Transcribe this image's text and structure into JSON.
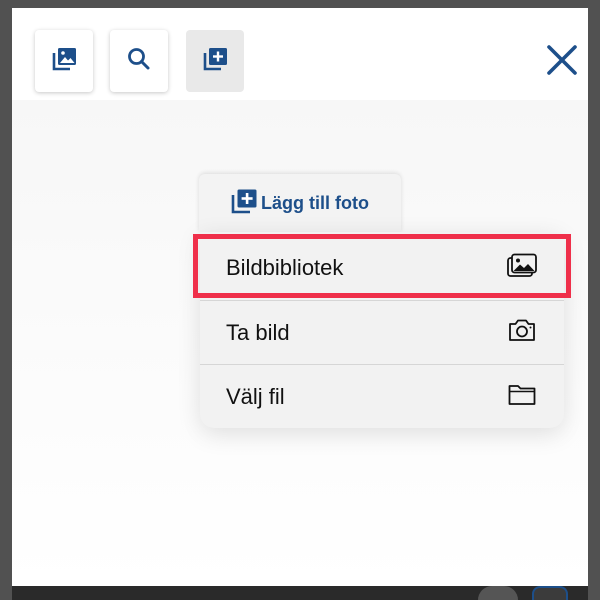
{
  "toolbar": {
    "gallery_icon": "photo-library-icon",
    "search_icon": "search-icon",
    "add_icon": "add-photo-icon",
    "close_icon": "close-icon"
  },
  "popover": {
    "tab_label": "Lägg till foto",
    "tab_icon": "add-photo-icon"
  },
  "menu": {
    "items": [
      {
        "label": "Bildbibliotek",
        "icon": "photo-library-icon"
      },
      {
        "label": "Ta bild",
        "icon": "camera-icon"
      },
      {
        "label": "Välj fil",
        "icon": "folder-icon"
      }
    ]
  },
  "colors": {
    "accent": "#1d4f8a",
    "highlight": "#ef2f4a",
    "menu_background": "#f2f2f2"
  }
}
